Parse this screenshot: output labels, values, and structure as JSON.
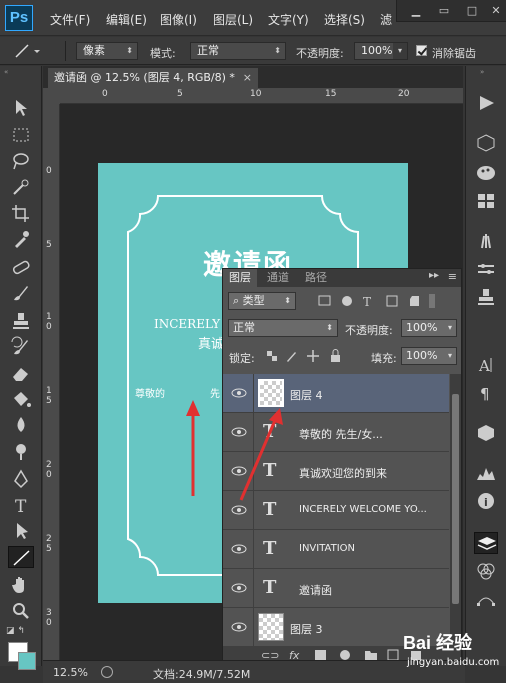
{
  "app": {
    "logo": "Ps"
  },
  "menu": [
    "文件(F)",
    "编辑(E)",
    "图像(I)",
    "图层(L)",
    "文字(Y)",
    "选择(S)",
    "滤"
  ],
  "options_bar": {
    "shape_mode": "像素",
    "mode_label": "模式:",
    "mode_value": "正常",
    "opacity_label": "不透明度:",
    "opacity_value": "100%",
    "antialias_label": "消除锯齿"
  },
  "document_tab": {
    "title": "邀请函 @ 12.5% (图层 4, RGB/8) *",
    "close": "×"
  },
  "ruler": {
    "h": [
      "0",
      "5",
      "10",
      "15",
      "20"
    ],
    "v": [
      "0",
      "5",
      "1 0",
      "1 5",
      "2 0",
      "2 5",
      "3 0"
    ]
  },
  "artboard": {
    "title": "邀请函",
    "subtitle": "INCERELY W",
    "line": "真诚",
    "dear": "尊敬的",
    "sir": "先"
  },
  "layers_panel": {
    "tabs": [
      "图层",
      "通道",
      "路径"
    ],
    "filter_type": "类型",
    "blend_mode": "正常",
    "opacity_label": "不透明度:",
    "opacity_value": "100%",
    "lock_label": "锁定:",
    "fill_label": "填充:",
    "fill_value": "100%",
    "layers": [
      {
        "name": "图层 4",
        "kind": "raster",
        "selected": true
      },
      {
        "name": "尊敬的          先生/女...",
        "kind": "text"
      },
      {
        "name": "真诚欢迎您的到来",
        "kind": "text"
      },
      {
        "name": "INCERELY WELCOME YO...",
        "kind": "text"
      },
      {
        "name": "INVITATION",
        "kind": "text"
      },
      {
        "name": "邀请函",
        "kind": "text"
      },
      {
        "name": "图层 3",
        "kind": "raster"
      }
    ]
  },
  "status_bar": {
    "zoom": "12.5%",
    "doc_info": "文档:24.9M/7.52M"
  },
  "colors": {
    "foreground": "#ffffff",
    "background": "#67c6c3",
    "accent": "#31a8ff"
  },
  "watermark": {
    "text": "Bai 经验",
    "url": "jingyan.baidu.com"
  }
}
